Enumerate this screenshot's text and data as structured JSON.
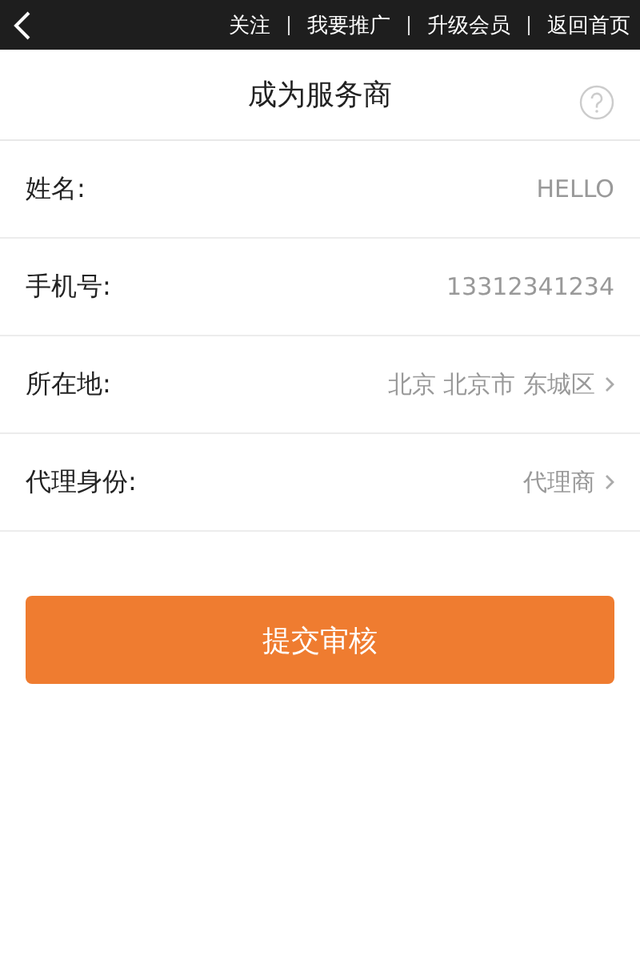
{
  "top_bar": {
    "links": [
      "关注",
      "我要推广",
      "升级会员",
      "返回首页"
    ]
  },
  "header": {
    "title": "成为服务商"
  },
  "form": {
    "rows": [
      {
        "label": "姓名:",
        "value": "HELLO",
        "kind": "input"
      },
      {
        "label": "手机号:",
        "value": "13312341234",
        "kind": "input"
      },
      {
        "label": "所在地:",
        "value": "北京 北京市 东城区",
        "kind": "select"
      },
      {
        "label": "代理身份:",
        "value": "代理商",
        "kind": "select"
      }
    ]
  },
  "submit_button": "提交审核"
}
